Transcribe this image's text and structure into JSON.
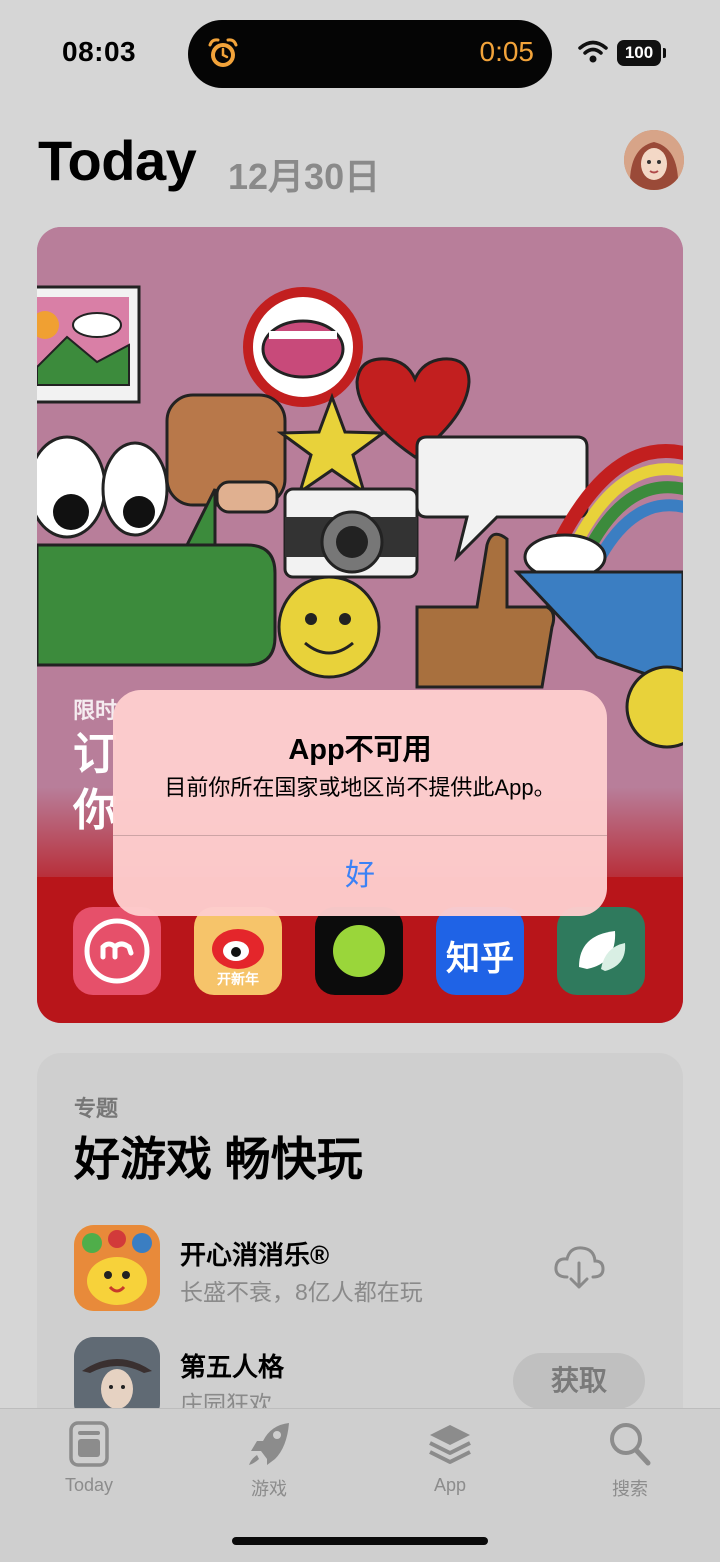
{
  "status_bar": {
    "time": "08:03",
    "timer": "0:05",
    "battery": "100"
  },
  "header": {
    "title": "Today",
    "date": "12月30日"
  },
  "feature_card": {
    "label": "限时",
    "headline": "订\n你",
    "apps": [
      {
        "name": "meitu-app",
        "color": "#e6506a"
      },
      {
        "name": "weibo-app",
        "text": "开新年"
      },
      {
        "name": "green-dot-app"
      },
      {
        "name": "zhihu-app",
        "text": "知乎"
      },
      {
        "name": "leaf-app"
      }
    ]
  },
  "collection": {
    "kicker": "专题",
    "title": "好游戏 畅快玩",
    "games": [
      {
        "name": "开心消消乐®",
        "subtitle": "长盛不衰，8亿人都在玩",
        "action": "cloud-download"
      },
      {
        "name": "第五人格",
        "subtitle": "庄园狂欢",
        "action": "获取"
      }
    ]
  },
  "alert": {
    "title": "App不可用",
    "message": "目前你所在国家或地区尚不提供此App。",
    "ok_label": "好"
  },
  "tab_bar": {
    "tabs": [
      {
        "label": "Today",
        "icon": "today-icon"
      },
      {
        "label": "游戏",
        "icon": "rocket-icon"
      },
      {
        "label": "App",
        "icon": "app-stack-icon"
      },
      {
        "label": "搜索",
        "icon": "search-icon"
      }
    ]
  },
  "colors": {
    "accent": "#3b82f6",
    "card_red": "#b8151a",
    "alarm": "#f2a33a"
  }
}
